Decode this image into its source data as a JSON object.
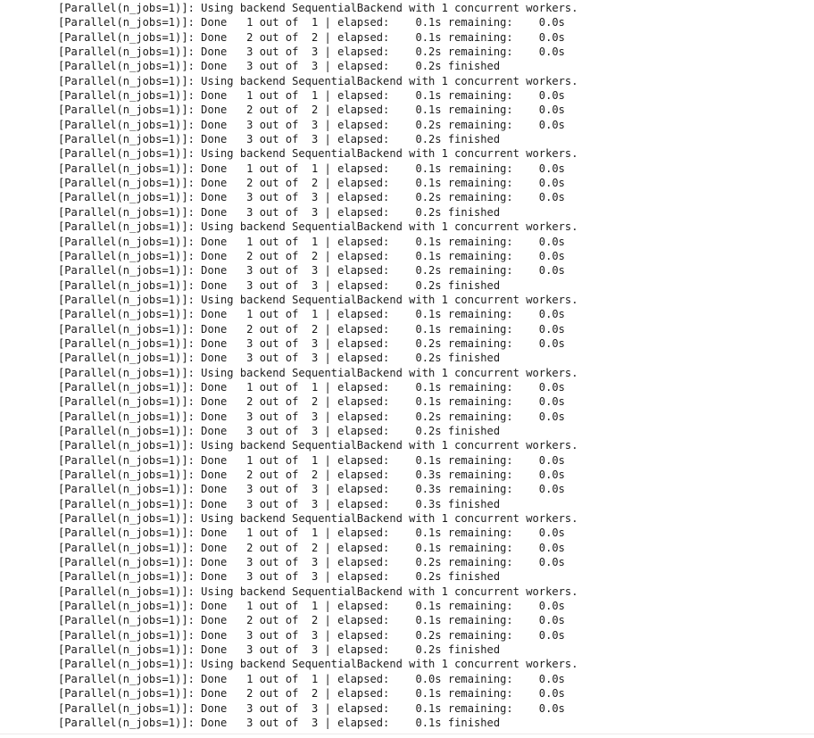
{
  "console": {
    "title": "joblib Parallel progress output",
    "prefix": "[Parallel(n_jobs=1)]:",
    "backend_message": "Using backend SequentialBackend with 1 concurrent workers.",
    "text_color": "#1b1b1b",
    "background_color": "#ffffff",
    "separator_color": "#eceaea",
    "blocks": [
      {
        "header": "[Parallel(n_jobs=1)]: Using backend SequentialBackend with 1 concurrent workers.",
        "rows": [
          {
            "status": "Done",
            "done": "1",
            "total": "1",
            "elapsed": "0.1s",
            "remaining": "0.0s",
            "finished": false
          },
          {
            "status": "Done",
            "done": "2",
            "total": "2",
            "elapsed": "0.1s",
            "remaining": "0.0s",
            "finished": false
          },
          {
            "status": "Done",
            "done": "3",
            "total": "3",
            "elapsed": "0.2s",
            "remaining": "0.0s",
            "finished": false
          },
          {
            "status": "Done",
            "done": "3",
            "total": "3",
            "elapsed": "0.2s",
            "remaining": null,
            "finished": true
          }
        ]
      },
      {
        "header": "[Parallel(n_jobs=1)]: Using backend SequentialBackend with 1 concurrent workers.",
        "rows": [
          {
            "status": "Done",
            "done": "1",
            "total": "1",
            "elapsed": "0.1s",
            "remaining": "0.0s",
            "finished": false
          },
          {
            "status": "Done",
            "done": "2",
            "total": "2",
            "elapsed": "0.1s",
            "remaining": "0.0s",
            "finished": false
          },
          {
            "status": "Done",
            "done": "3",
            "total": "3",
            "elapsed": "0.2s",
            "remaining": "0.0s",
            "finished": false
          },
          {
            "status": "Done",
            "done": "3",
            "total": "3",
            "elapsed": "0.2s",
            "remaining": null,
            "finished": true
          }
        ]
      },
      {
        "header": "[Parallel(n_jobs=1)]: Using backend SequentialBackend with 1 concurrent workers.",
        "rows": [
          {
            "status": "Done",
            "done": "1",
            "total": "1",
            "elapsed": "0.1s",
            "remaining": "0.0s",
            "finished": false
          },
          {
            "status": "Done",
            "done": "2",
            "total": "2",
            "elapsed": "0.1s",
            "remaining": "0.0s",
            "finished": false
          },
          {
            "status": "Done",
            "done": "3",
            "total": "3",
            "elapsed": "0.2s",
            "remaining": "0.0s",
            "finished": false
          },
          {
            "status": "Done",
            "done": "3",
            "total": "3",
            "elapsed": "0.2s",
            "remaining": null,
            "finished": true
          }
        ]
      },
      {
        "header": "[Parallel(n_jobs=1)]: Using backend SequentialBackend with 1 concurrent workers.",
        "rows": [
          {
            "status": "Done",
            "done": "1",
            "total": "1",
            "elapsed": "0.1s",
            "remaining": "0.0s",
            "finished": false
          },
          {
            "status": "Done",
            "done": "2",
            "total": "2",
            "elapsed": "0.1s",
            "remaining": "0.0s",
            "finished": false
          },
          {
            "status": "Done",
            "done": "3",
            "total": "3",
            "elapsed": "0.2s",
            "remaining": "0.0s",
            "finished": false
          },
          {
            "status": "Done",
            "done": "3",
            "total": "3",
            "elapsed": "0.2s",
            "remaining": null,
            "finished": true
          }
        ]
      },
      {
        "header": "[Parallel(n_jobs=1)]: Using backend SequentialBackend with 1 concurrent workers.",
        "rows": [
          {
            "status": "Done",
            "done": "1",
            "total": "1",
            "elapsed": "0.1s",
            "remaining": "0.0s",
            "finished": false
          },
          {
            "status": "Done",
            "done": "2",
            "total": "2",
            "elapsed": "0.1s",
            "remaining": "0.0s",
            "finished": false
          },
          {
            "status": "Done",
            "done": "3",
            "total": "3",
            "elapsed": "0.2s",
            "remaining": "0.0s",
            "finished": false
          },
          {
            "status": "Done",
            "done": "3",
            "total": "3",
            "elapsed": "0.2s",
            "remaining": null,
            "finished": true
          }
        ]
      },
      {
        "header": "[Parallel(n_jobs=1)]: Using backend SequentialBackend with 1 concurrent workers.",
        "rows": [
          {
            "status": "Done",
            "done": "1",
            "total": "1",
            "elapsed": "0.1s",
            "remaining": "0.0s",
            "finished": false
          },
          {
            "status": "Done",
            "done": "2",
            "total": "2",
            "elapsed": "0.1s",
            "remaining": "0.0s",
            "finished": false
          },
          {
            "status": "Done",
            "done": "3",
            "total": "3",
            "elapsed": "0.2s",
            "remaining": "0.0s",
            "finished": false
          },
          {
            "status": "Done",
            "done": "3",
            "total": "3",
            "elapsed": "0.2s",
            "remaining": null,
            "finished": true
          }
        ]
      },
      {
        "header": "[Parallel(n_jobs=1)]: Using backend SequentialBackend with 1 concurrent workers.",
        "rows": [
          {
            "status": "Done",
            "done": "1",
            "total": "1",
            "elapsed": "0.1s",
            "remaining": "0.0s",
            "finished": false
          },
          {
            "status": "Done",
            "done": "2",
            "total": "2",
            "elapsed": "0.3s",
            "remaining": "0.0s",
            "finished": false
          },
          {
            "status": "Done",
            "done": "3",
            "total": "3",
            "elapsed": "0.3s",
            "remaining": "0.0s",
            "finished": false
          },
          {
            "status": "Done",
            "done": "3",
            "total": "3",
            "elapsed": "0.3s",
            "remaining": null,
            "finished": true
          }
        ]
      },
      {
        "header": "[Parallel(n_jobs=1)]: Using backend SequentialBackend with 1 concurrent workers.",
        "rows": [
          {
            "status": "Done",
            "done": "1",
            "total": "1",
            "elapsed": "0.1s",
            "remaining": "0.0s",
            "finished": false
          },
          {
            "status": "Done",
            "done": "2",
            "total": "2",
            "elapsed": "0.1s",
            "remaining": "0.0s",
            "finished": false
          },
          {
            "status": "Done",
            "done": "3",
            "total": "3",
            "elapsed": "0.2s",
            "remaining": "0.0s",
            "finished": false
          },
          {
            "status": "Done",
            "done": "3",
            "total": "3",
            "elapsed": "0.2s",
            "remaining": null,
            "finished": true
          }
        ]
      },
      {
        "header": "[Parallel(n_jobs=1)]: Using backend SequentialBackend with 1 concurrent workers.",
        "rows": [
          {
            "status": "Done",
            "done": "1",
            "total": "1",
            "elapsed": "0.1s",
            "remaining": "0.0s",
            "finished": false
          },
          {
            "status": "Done",
            "done": "2",
            "total": "2",
            "elapsed": "0.1s",
            "remaining": "0.0s",
            "finished": false
          },
          {
            "status": "Done",
            "done": "3",
            "total": "3",
            "elapsed": "0.2s",
            "remaining": "0.0s",
            "finished": false
          },
          {
            "status": "Done",
            "done": "3",
            "total": "3",
            "elapsed": "0.2s",
            "remaining": null,
            "finished": true
          }
        ]
      },
      {
        "header": "[Parallel(n_jobs=1)]: Using backend SequentialBackend with 1 concurrent workers.",
        "rows": [
          {
            "status": "Done",
            "done": "1",
            "total": "1",
            "elapsed": "0.0s",
            "remaining": "0.0s",
            "finished": false
          },
          {
            "status": "Done",
            "done": "2",
            "total": "2",
            "elapsed": "0.1s",
            "remaining": "0.0s",
            "finished": false
          },
          {
            "status": "Done",
            "done": "3",
            "total": "3",
            "elapsed": "0.1s",
            "remaining": "0.0s",
            "finished": false
          },
          {
            "status": "Done",
            "done": "3",
            "total": "3",
            "elapsed": "0.1s",
            "remaining": null,
            "finished": true
          }
        ]
      }
    ]
  }
}
